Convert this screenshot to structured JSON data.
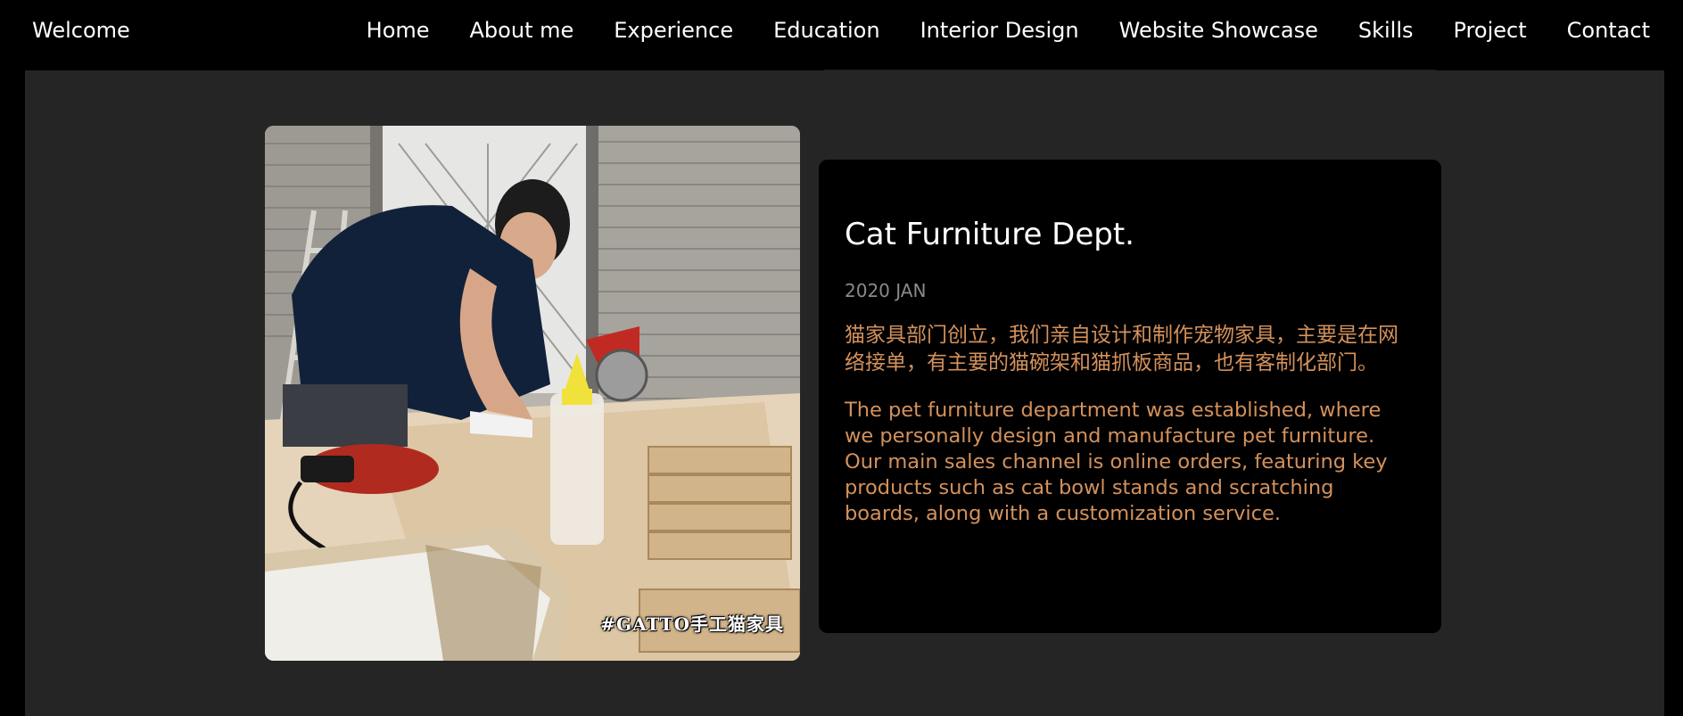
{
  "nav": {
    "brand": "Welcome",
    "links": [
      "Home",
      "About me",
      "Experience",
      "Education",
      "Interior Design",
      "Website Showcase",
      "Skills",
      "Project",
      "Contact"
    ]
  },
  "entry": {
    "title": "Cat Furniture Dept.",
    "date": "2020 JAN",
    "description_zh": "猫家具部门创立，我们亲自设计和制作宠物家具，主要是在网络接单，有主要的猫碗架和猫抓板商品，也有客制化部门。",
    "description_en": "The pet furniture department was established, where we personally design and manufacture pet furniture. Our main sales channel is online orders, featuring key products such as cat bowl stands and scratching boards, along with a customization service.",
    "photo_watermark": "#GATTO手工猫家具"
  },
  "colors": {
    "page_bg": "#000000",
    "panel_bg": "#252525",
    "card_bg": "#000000",
    "accent_text": "#d4915b",
    "muted_text": "#8a8a8a"
  }
}
